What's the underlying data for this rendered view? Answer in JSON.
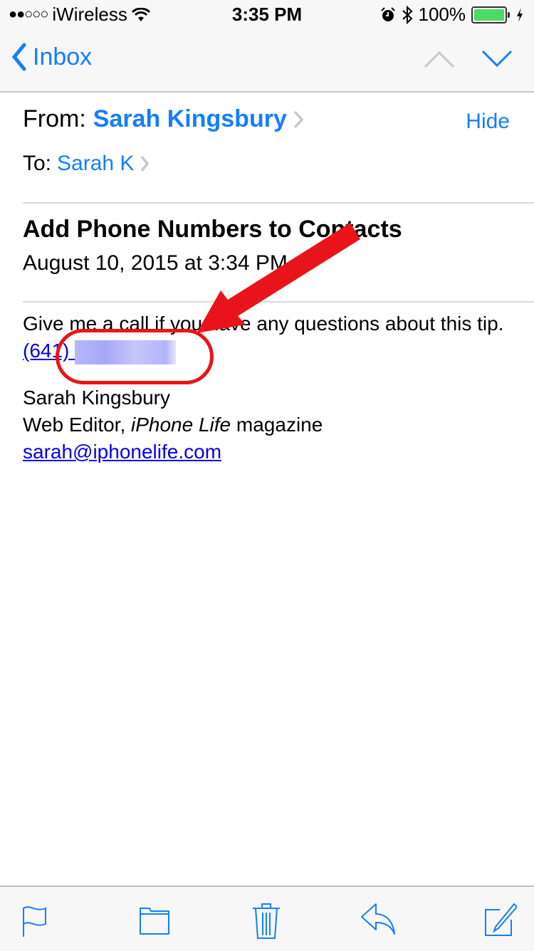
{
  "status_bar": {
    "signal": "●●○○○",
    "carrier": "iWireless",
    "time": "3:35 PM",
    "battery_percent": "100%",
    "battery_level": 1.0,
    "icons": [
      "wifi-icon",
      "alarm-icon",
      "bluetooth-icon",
      "battery-icon",
      "charging-icon"
    ]
  },
  "nav": {
    "back_label": "Inbox",
    "prev_message_enabled": false,
    "next_message_enabled": true
  },
  "message": {
    "from_label": "From:",
    "from_name": "Sarah Kingsbury",
    "hide_label": "Hide",
    "to_label": "To:",
    "to_name": "Sarah K",
    "subject": "Add Phone Numbers to Contacts",
    "date": "August 10, 2015 at 3:34 PM",
    "body_line1": "Give me a call if you have any questions about this tip.",
    "phone_visible": "(641) ",
    "signature_name": "Sarah Kingsbury",
    "signature_title_prefix": "Web Editor, ",
    "signature_publication": "iPhone Life",
    "signature_title_suffix": " magazine",
    "signature_email": "sarah@iphonelife.com"
  },
  "annotation": {
    "color": "#e9141b",
    "shapes": [
      "arrow",
      "circle"
    ]
  },
  "toolbar": {
    "buttons": [
      "flag",
      "move-to-folder",
      "trash",
      "reply",
      "compose"
    ]
  },
  "colors": {
    "accent": "#157efb",
    "link": "#0000ee",
    "battery": "#4cd964"
  }
}
